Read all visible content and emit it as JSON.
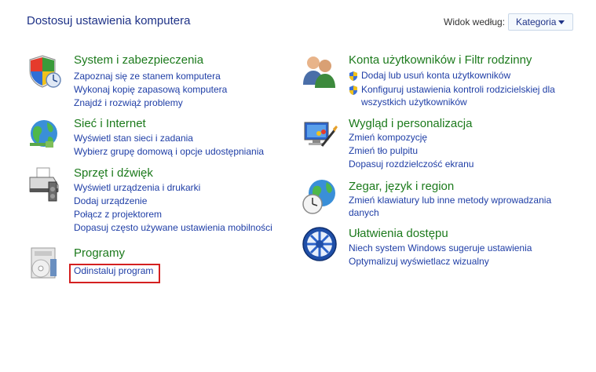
{
  "header": {
    "title": "Dostosuj ustawienia komputera",
    "view_label": "Widok według:",
    "view_value": "Kategoria"
  },
  "categories": {
    "system": {
      "title": "System i zabezpieczenia",
      "links": [
        "Zapoznaj się ze stanem komputera",
        "Wykonaj kopię zapasową komputera",
        "Znajdź i rozwiąż problemy"
      ],
      "icon": "shield-security-icon"
    },
    "network": {
      "title": "Sieć i Internet",
      "links": [
        "Wyświetl stan sieci i zadania",
        "Wybierz grupę domową i opcje udostępniania"
      ],
      "icon": "globe-network-icon"
    },
    "hardware": {
      "title": "Sprzęt i dźwięk",
      "links": [
        "Wyświetl urządzenia i drukarki",
        "Dodaj urządzenie",
        "Połącz z projektorem",
        "Dopasuj często używane ustawienia mobilności"
      ],
      "icon": "printer-icon"
    },
    "programs": {
      "title": "Programy",
      "links": [
        "Odinstaluj program"
      ],
      "icon": "programs-icon"
    },
    "users": {
      "title": "Konta użytkowników i Filtr rodzinny",
      "links": [
        "Dodaj lub usuń konta użytkowników",
        "Konfiguruj ustawienia kontroli rodzicielskiej dla",
        "wszystkich użytkowników"
      ],
      "icon": "users-icon"
    },
    "appearance": {
      "title": "Wygląd i personalizacja",
      "links": [
        "Zmień kompozycję",
        "Zmień tło pulpitu",
        "Dopasuj rozdzielczość ekranu"
      ],
      "icon": "monitor-paint-icon"
    },
    "clock": {
      "title": "Zegar, język i region",
      "links": [
        "Zmień klawiatury lub inne metody wprowadzania",
        "danych"
      ],
      "icon": "clock-globe-icon"
    },
    "ease": {
      "title": "Ułatwienia dostępu",
      "links": [
        "Niech system Windows sugeruje ustawienia",
        "Optymalizuj wyświetlacz wizualny"
      ],
      "icon": "ease-of-access-icon"
    }
  }
}
